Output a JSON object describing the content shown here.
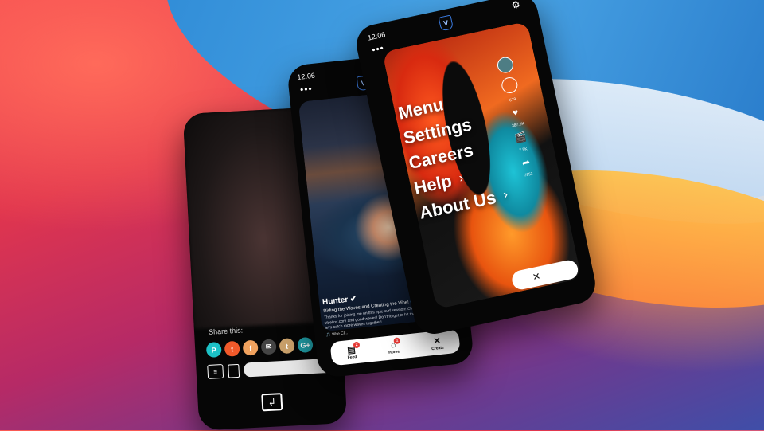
{
  "phones": {
    "share": {
      "share_label": "Share this:",
      "share_services": [
        {
          "name": "pinterest-icon",
          "glyph": "P",
          "color": "#1cc1c6"
        },
        {
          "name": "twitter-icon",
          "glyph": "t",
          "color": "#f1592a"
        },
        {
          "name": "facebook-icon",
          "glyph": "f",
          "color": "#f1a25e"
        },
        {
          "name": "email-icon",
          "glyph": "✉",
          "color": "#444444"
        },
        {
          "name": "tumblr-icon",
          "glyph": "t",
          "color": "#c9a06a"
        },
        {
          "name": "google-plus-icon",
          "glyph": "G+",
          "color": "#1f9aa3"
        }
      ]
    },
    "feed": {
      "time": "12:06",
      "logo": "V",
      "user": "Hunter ✔",
      "caption_title": "Riding the Waves and Creating the Vibe! 🌊🏄",
      "caption_body": "Thanks for joining me on this epic surf session! Check out more vibes at vibelinx.com and good waves! Don't forget to hit that follow button and let's catch more waves together!",
      "sound": "🎵 Vibe Cl...",
      "nav": [
        {
          "label": "Feed",
          "glyph": "▤",
          "badge": "2"
        },
        {
          "label": "Home",
          "glyph": "⌂",
          "badge": "1"
        },
        {
          "label": "Create",
          "glyph": "✕",
          "badge": ""
        }
      ]
    },
    "menu": {
      "time": "12:06",
      "logo": "V",
      "items": [
        {
          "label": "Menu",
          "chevron": false
        },
        {
          "label": "Settings",
          "chevron": false
        },
        {
          "label": "Careers",
          "chevron": false
        },
        {
          "label": "Help",
          "chevron": true
        },
        {
          "label": "About Us",
          "chevron": true
        }
      ],
      "counts": [
        "679",
        "387.2K",
        "7.5K",
        "7853"
      ],
      "create_icon": "✕"
    }
  },
  "colors": {
    "brand": "#3b7be0"
  }
}
